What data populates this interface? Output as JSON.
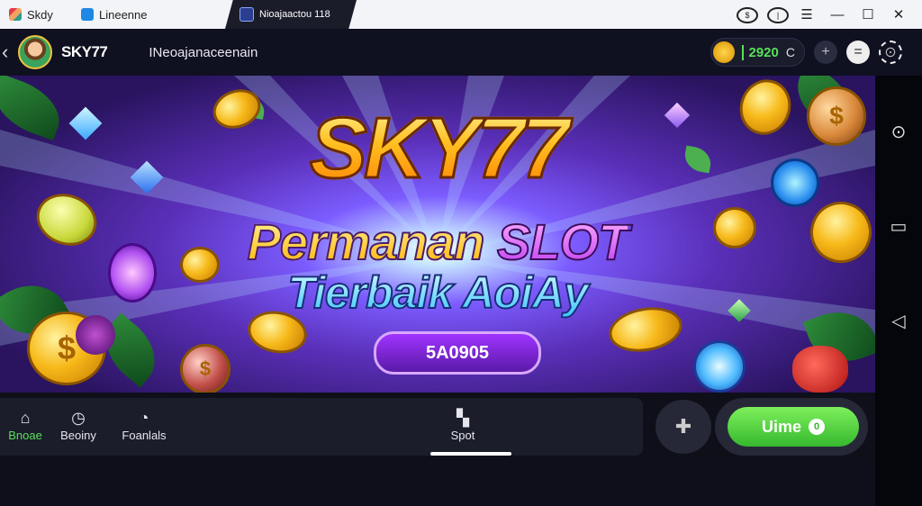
{
  "window": {
    "tabs": [
      {
        "label": "Skdy",
        "icon": "stack-icon"
      },
      {
        "label": "Lineenne",
        "icon": "blue-square-icon"
      },
      {
        "label": "Nioajaactou  118",
        "icon": "app-icon"
      }
    ],
    "controls": [
      "info-icon",
      "power-icon",
      "menu-icon",
      "minimize-icon",
      "maximize-icon",
      "close-icon"
    ]
  },
  "header": {
    "brand": "SKY77",
    "subtitle": "INeoajanaceenain",
    "coins": "2920",
    "refresh_glyph": "C"
  },
  "banner": {
    "title": "SKY77",
    "line1_a": "Permanan",
    "line1_b": "SLOT",
    "line2": "Tierbaik AoiAy",
    "promo_code": "5A0905"
  },
  "bottom_nav": {
    "items": [
      {
        "label": "Bnoae",
        "icon": "home-icon",
        "active": true
      },
      {
        "label": "Beoiny",
        "icon": "clock-icon",
        "active": false
      },
      {
        "label": "Foanlals",
        "icon": "chat-icon",
        "active": false
      },
      {
        "label": "Spot",
        "icon": "grid-icon",
        "active": false
      }
    ],
    "cta_label": "Uime",
    "cta_badge": "0"
  },
  "colors": {
    "accent_green": "#59e05a",
    "banner_purple": "#5a2fb8",
    "gold": "#f7b91a"
  }
}
